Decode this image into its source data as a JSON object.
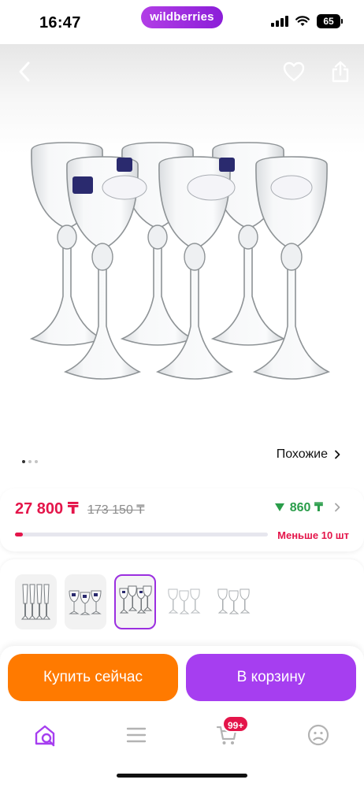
{
  "status_bar": {
    "time": "16:47",
    "brand": "wildberries",
    "battery": "65"
  },
  "gallery": {
    "icons": [
      "back-arrow-icon",
      "heart-icon",
      "share-icon"
    ],
    "dots_total": 3,
    "dots_active": 1,
    "similar_label": "Похожие"
  },
  "price": {
    "current": "27 800 ₸",
    "old": "173 150 ₸",
    "cashback": "860 ₸",
    "stock_label": "Меньше 10 шт",
    "stock_fraction": 0.03,
    "colors": {
      "price": "#e4154a",
      "cashback": "#2a9d4a"
    }
  },
  "variants": {
    "count": 5,
    "selected_index": 2
  },
  "actions": {
    "buy_now": "Купить сейчас",
    "add_to_cart": "В корзину",
    "colors": {
      "buy_now": "#ff7a00",
      "add_to_cart": "#a63ef0"
    }
  },
  "tabbar": {
    "items": [
      "home-search-icon",
      "catalog-icon",
      "cart-icon",
      "profile-icon"
    ],
    "cart_badge": "99+"
  }
}
